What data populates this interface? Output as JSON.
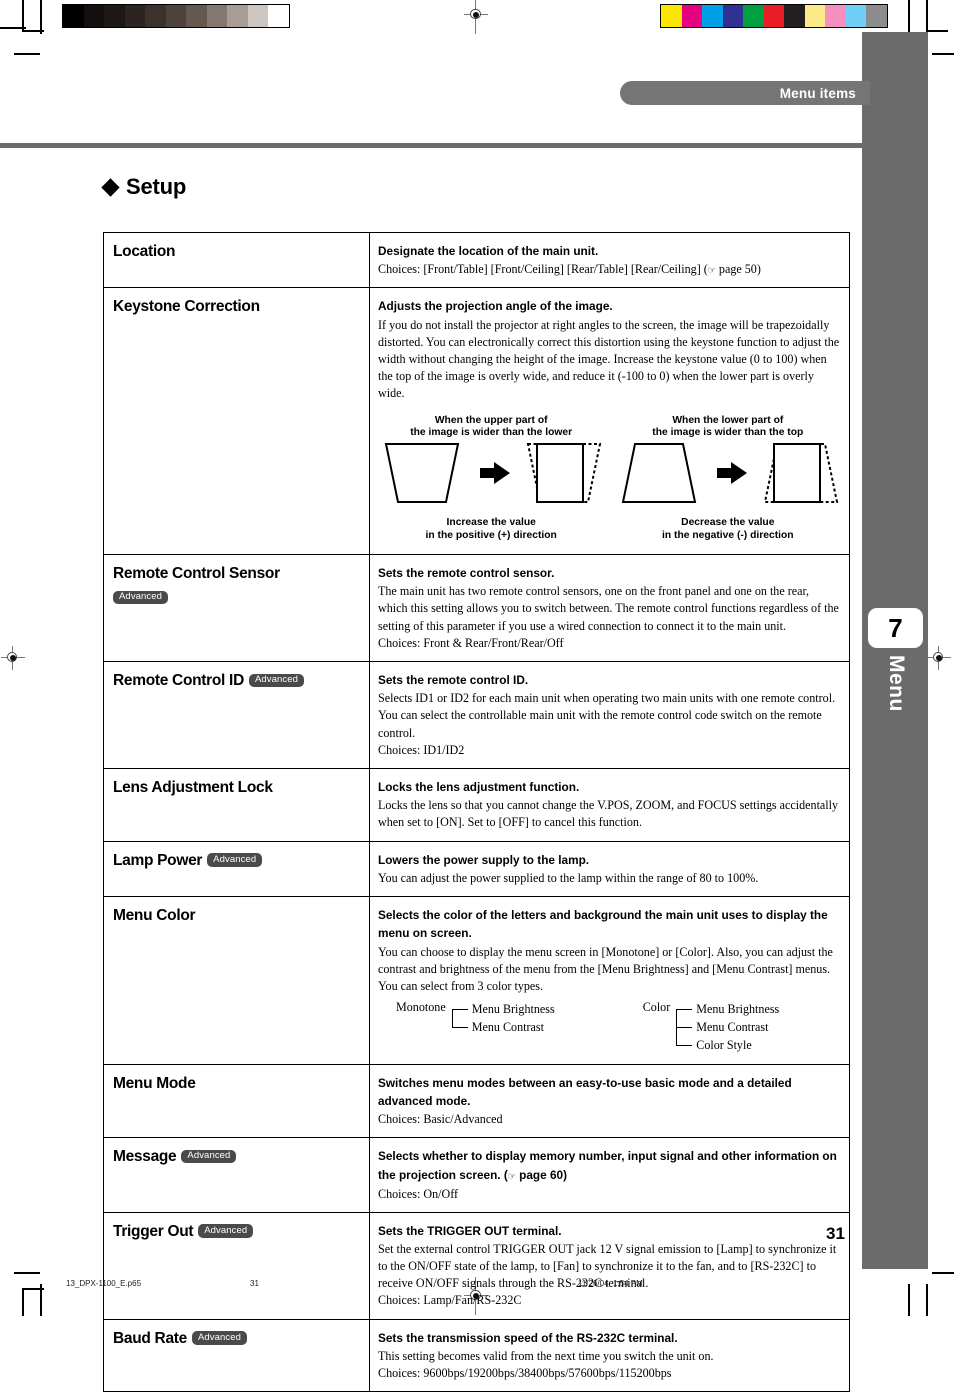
{
  "header": {
    "running_head": "Menu items",
    "section_title": "Setup"
  },
  "side_tab": {
    "number": "7",
    "label": "Menu"
  },
  "page_number": "31",
  "footer": {
    "filename": "13_DPX-1100_E.p65",
    "page": "31",
    "timestamp": "11/26/04, 1:54 PM"
  },
  "colors": {
    "side_tab_gray": "#6b6b6b",
    "header_pill_gray": "#757575",
    "badge_gray": "#4a4a4a",
    "grayscale_strip": [
      "#000000",
      "#120f0e",
      "#1d1815",
      "#2b2421",
      "#3b322d",
      "#4d423c",
      "#65584f",
      "#83776f",
      "#a89d95",
      "#cdc5bf",
      "#ffffff"
    ],
    "color_strip": [
      "#fbe700",
      "#e4007f",
      "#00a0e9",
      "#2e3192",
      "#00a040",
      "#ea1d24",
      "#231f20",
      "#fbe98a",
      "#f48fc0",
      "#6fcff6",
      "#8d8d8d"
    ]
  },
  "table": {
    "rows": [
      {
        "name": "Location",
        "badge": null,
        "badge_position": null,
        "heading": "Designate the location of the main unit.",
        "body": [],
        "choices": "Choices: [Front/Table] [Front/Ceiling] [Rear/Table] [Rear/Ceiling] (☞ page 50)"
      },
      {
        "name": "Keystone Correction",
        "badge": null,
        "badge_position": null,
        "heading": "Adjusts the projection angle of the image.",
        "body": [
          "If you do not install the projector at right angles to the screen, the image will be trapezoidally distorted. You can electronically correct this distortion using the keystone function to adjust the width without changing the height of the image. Increase the keystone value (0 to 100) when the top of the image is overly wide, and reduce it (-100 to 0) when the lower part is overly wide."
        ],
        "choices": null,
        "figure": {
          "left": {
            "caption_top": "When the upper part of\nthe image is wider than the lower",
            "caption_bottom": "Increase the value\nin the positive (+) direction"
          },
          "right": {
            "caption_top": "When the lower part of\nthe image is wider than the top",
            "caption_bottom": "Decrease the value\nin the negative (-) direction"
          }
        }
      },
      {
        "name": "Remote Control Sensor",
        "badge": "Advanced",
        "badge_position": "below",
        "heading": "Sets the remote control sensor.",
        "body": [
          "The main unit has two remote control sensors, one on the front panel and one on the rear, which this setting allows you to switch between.  The remote control functions regardless of the setting of this parameter if you use a wired connection to connect it to the main unit."
        ],
        "choices": "Choices: Front & Rear/Front/Rear/Off"
      },
      {
        "name": "Remote Control ID",
        "badge": "Advanced",
        "badge_position": "inline",
        "heading": "Sets the remote control ID.",
        "body": [
          "Selects ID1 or ID2 for each main unit when operating two main units with one remote control. You can select the controllable main unit with the remote control code switch on the remote control."
        ],
        "choices": "Choices: ID1/ID2"
      },
      {
        "name": "Lens Adjustment Lock",
        "badge": null,
        "badge_position": null,
        "heading": "Locks the lens adjustment function.",
        "body": [
          "Locks the lens so that you cannot change the V.POS, ZOOM, and FOCUS settings accidentally when set to [ON]. Set to [OFF] to cancel this function."
        ],
        "choices": null
      },
      {
        "name": "Lamp Power",
        "badge": "Advanced",
        "badge_position": "inline",
        "heading": "Lowers the power supply to the lamp.",
        "body": [
          "You can adjust the power supplied to the lamp within the range of 80 to 100%."
        ],
        "choices": null
      },
      {
        "name": "Menu Color",
        "badge": null,
        "badge_position": null,
        "heading": "Selects the color of the letters and background the main unit uses to display the menu on screen.",
        "body": [
          "You can choose to display the menu screen in [Monotone] or [Color]. Also, you can adjust the contrast and brightness of the menu from the [Menu Brightness] and [Menu Contrast] menus. You can select from 3 color types."
        ],
        "choices": null,
        "tree": {
          "left_root": "Monotone",
          "left_children": [
            "Menu Brightness",
            "Menu Contrast"
          ],
          "right_root": "Color",
          "right_children": [
            "Menu Brightness",
            "Menu Contrast",
            "Color Style"
          ]
        }
      },
      {
        "name": "Menu Mode",
        "badge": null,
        "badge_position": null,
        "heading": "Switches menu modes between an easy-to-use basic mode and a detailed advanced mode.",
        "body": [],
        "choices": "Choices: Basic/Advanced"
      },
      {
        "name": "Message",
        "badge": "Advanced",
        "badge_position": "inline",
        "heading": "Selects whether to display memory number, input signal and other information on the projection screen. (☞ page 60)",
        "body": [],
        "choices": "Choices: On/Off"
      },
      {
        "name": "Trigger Out",
        "badge": "Advanced",
        "badge_position": "inline",
        "heading": "Sets the TRIGGER OUT terminal.",
        "body": [
          "Set the external control TRIGGER OUT jack 12 V signal emission to [Lamp] to synchronize it to the ON/OFF state of the lamp, to [Fan] to synchronize it to the fan, and to [RS-232C] to receive ON/OFF signals through the RS-232C terminal."
        ],
        "choices": "Choices: Lamp/Fan/RS-232C"
      },
      {
        "name": "Baud Rate",
        "badge": "Advanced",
        "badge_position": "inline",
        "heading": "Sets the transmission speed of the RS-232C terminal.",
        "body": [
          "This setting becomes valid from the next time you switch the unit on."
        ],
        "choices": "Choices: 9600bps/19200bps/38400bps/57600bps/115200bps"
      }
    ]
  }
}
